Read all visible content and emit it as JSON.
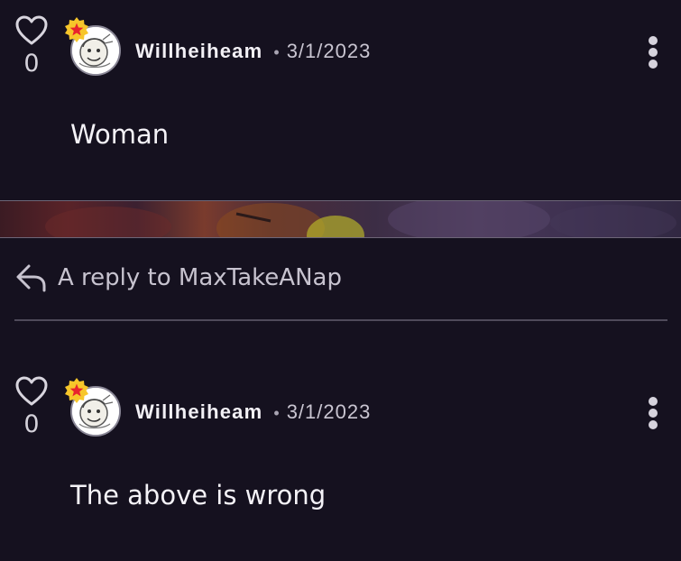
{
  "comments": [
    {
      "like_count": "0",
      "username": "Willheiheam",
      "separator": "•",
      "date": "3/1/2023",
      "text": "Woman"
    },
    {
      "like_count": "0",
      "username": "Willheiheam",
      "separator": "•",
      "date": "3/1/2023",
      "text": "The above is wrong"
    }
  ],
  "reply": {
    "label": "A reply to MaxTakeANap"
  },
  "icons": {
    "like": "heart-icon",
    "badge": "star-badge-icon",
    "menu": "more-vertical-icon",
    "reply": "reply-arrow-icon"
  },
  "colors": {
    "background": "#15111f",
    "badge_star": "#e8232d",
    "badge_bg": "#f7c62a",
    "text": "#f4f2f7",
    "muted": "#c7c3cf"
  }
}
